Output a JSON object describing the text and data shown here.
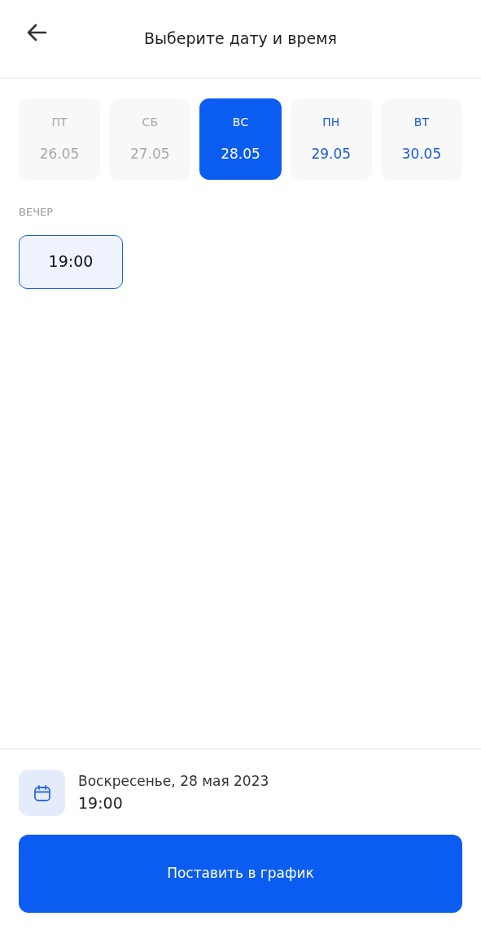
{
  "header": {
    "title": "Выберите дату и время"
  },
  "days": [
    {
      "weekday": "ПТ",
      "date": "26.05",
      "selected": false,
      "disabled": true
    },
    {
      "weekday": "СБ",
      "date": "27.05",
      "selected": false,
      "disabled": true
    },
    {
      "weekday": "ВС",
      "date": "28.05",
      "selected": true,
      "disabled": false
    },
    {
      "weekday": "ПН",
      "date": "29.05",
      "selected": false,
      "disabled": false
    },
    {
      "weekday": "ВТ",
      "date": "30.05",
      "selected": false,
      "disabled": false
    }
  ],
  "period_label": "ВЕЧЕР",
  "slots": [
    {
      "time": "19:00",
      "selected": true
    }
  ],
  "summary": {
    "date": "Воскресенье, 28 мая 2023",
    "time": "19:00"
  },
  "submit_button": "Поставить в график"
}
